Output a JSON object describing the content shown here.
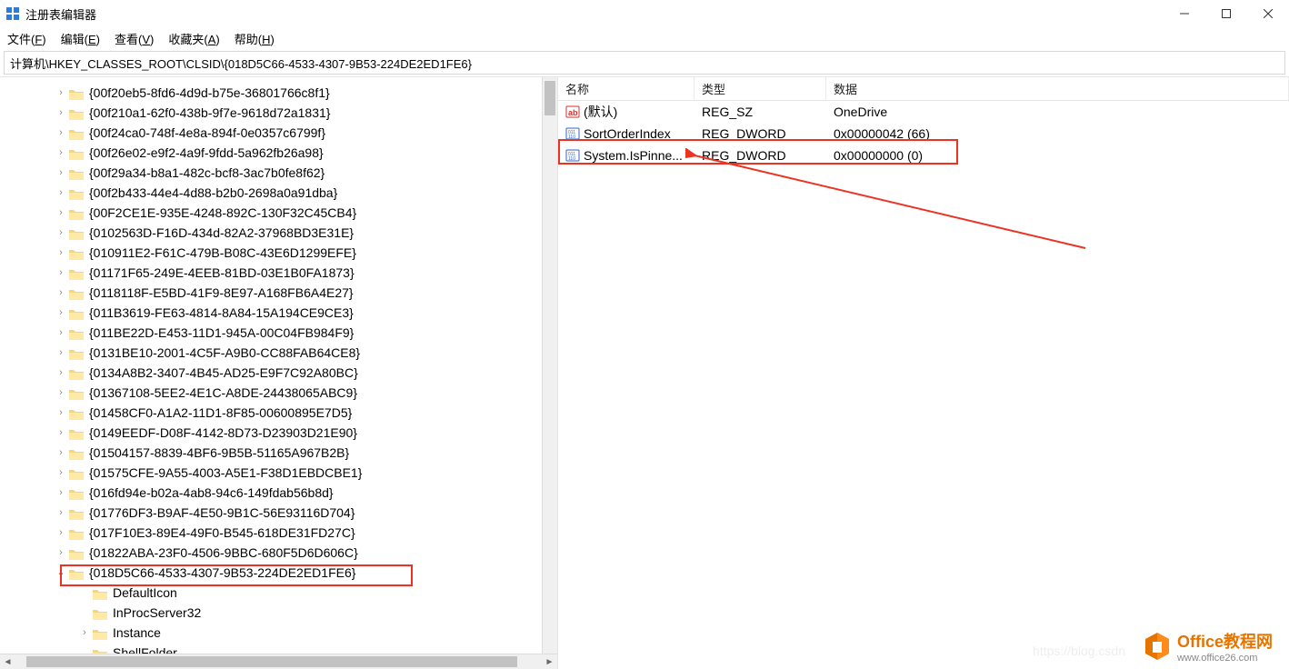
{
  "window": {
    "title": "注册表编辑器"
  },
  "menu": {
    "file": "文件(F)",
    "edit": "编辑(E)",
    "view": "查看(V)",
    "favorites": "收藏夹(A)",
    "help": "帮助(H)"
  },
  "address": "计算机\\HKEY_CLASSES_ROOT\\CLSID\\{018D5C66-4533-4307-9B53-224DE2ED1FE6}",
  "tree": [
    "{00f20eb5-8fd6-4d9d-b75e-36801766c8f1}",
    "{00f210a1-62f0-438b-9f7e-9618d72a1831}",
    "{00f24ca0-748f-4e8a-894f-0e0357c6799f}",
    "{00f26e02-e9f2-4a9f-9fdd-5a962fb26a98}",
    "{00f29a34-b8a1-482c-bcf8-3ac7b0fe8f62}",
    "{00f2b433-44e4-4d88-b2b0-2698a0a91dba}",
    "{00F2CE1E-935E-4248-892C-130F32C45CB4}",
    "{0102563D-F16D-434d-82A2-37968BD3E31E}",
    "{010911E2-F61C-479B-B08C-43E6D1299EFE}",
    "{01171F65-249E-4EEB-81BD-03E1B0FA1873}",
    "{0118118F-E5BD-41F9-8E97-A168FB6A4E27}",
    "{011B3619-FE63-4814-8A84-15A194CE9CE3}",
    "{011BE22D-E453-11D1-945A-00C04FB984F9}",
    "{0131BE10-2001-4C5F-A9B0-CC88FAB64CE8}",
    "{0134A8B2-3407-4B45-AD25-E9F7C92A80BC}",
    "{01367108-5EE2-4E1C-A8DE-24438065ABC9}",
    "{01458CF0-A1A2-11D1-8F85-00600895E7D5}",
    "{0149EEDF-D08F-4142-8D73-D23903D21E90}",
    "{01504157-8839-4BF6-9B5B-51165A967B2B}",
    "{01575CFE-9A55-4003-A5E1-F38D1EBDCBE1}",
    "{016fd94e-b02a-4ab8-94c6-149fdab56b8d}",
    "{01776DF3-B9AF-4E50-9B1C-56E93116D704}",
    "{017F10E3-89E4-49F0-B545-618DE31FD27C}",
    "{01822ABA-23F0-4506-9BBC-680F5D6D606C}"
  ],
  "selected_key": "{018D5C66-4533-4307-9B53-224DE2ED1FE6}",
  "children": [
    "DefaultIcon",
    "InProcServer32",
    "Instance",
    "ShellFolder"
  ],
  "columns": {
    "name": "名称",
    "type": "类型",
    "data": "数据"
  },
  "values": [
    {
      "icon": "str",
      "name": "(默认)",
      "type": "REG_SZ",
      "data": "OneDrive"
    },
    {
      "icon": "bin",
      "name": "SortOrderIndex",
      "type": "REG_DWORD",
      "data": "0x00000042 (66)"
    },
    {
      "icon": "bin",
      "name": "System.IsPinne...",
      "type": "REG_DWORD",
      "data": "0x00000000 (0)"
    }
  ],
  "watermark": {
    "brand": "Office教程网",
    "url": "www.office26.com"
  }
}
